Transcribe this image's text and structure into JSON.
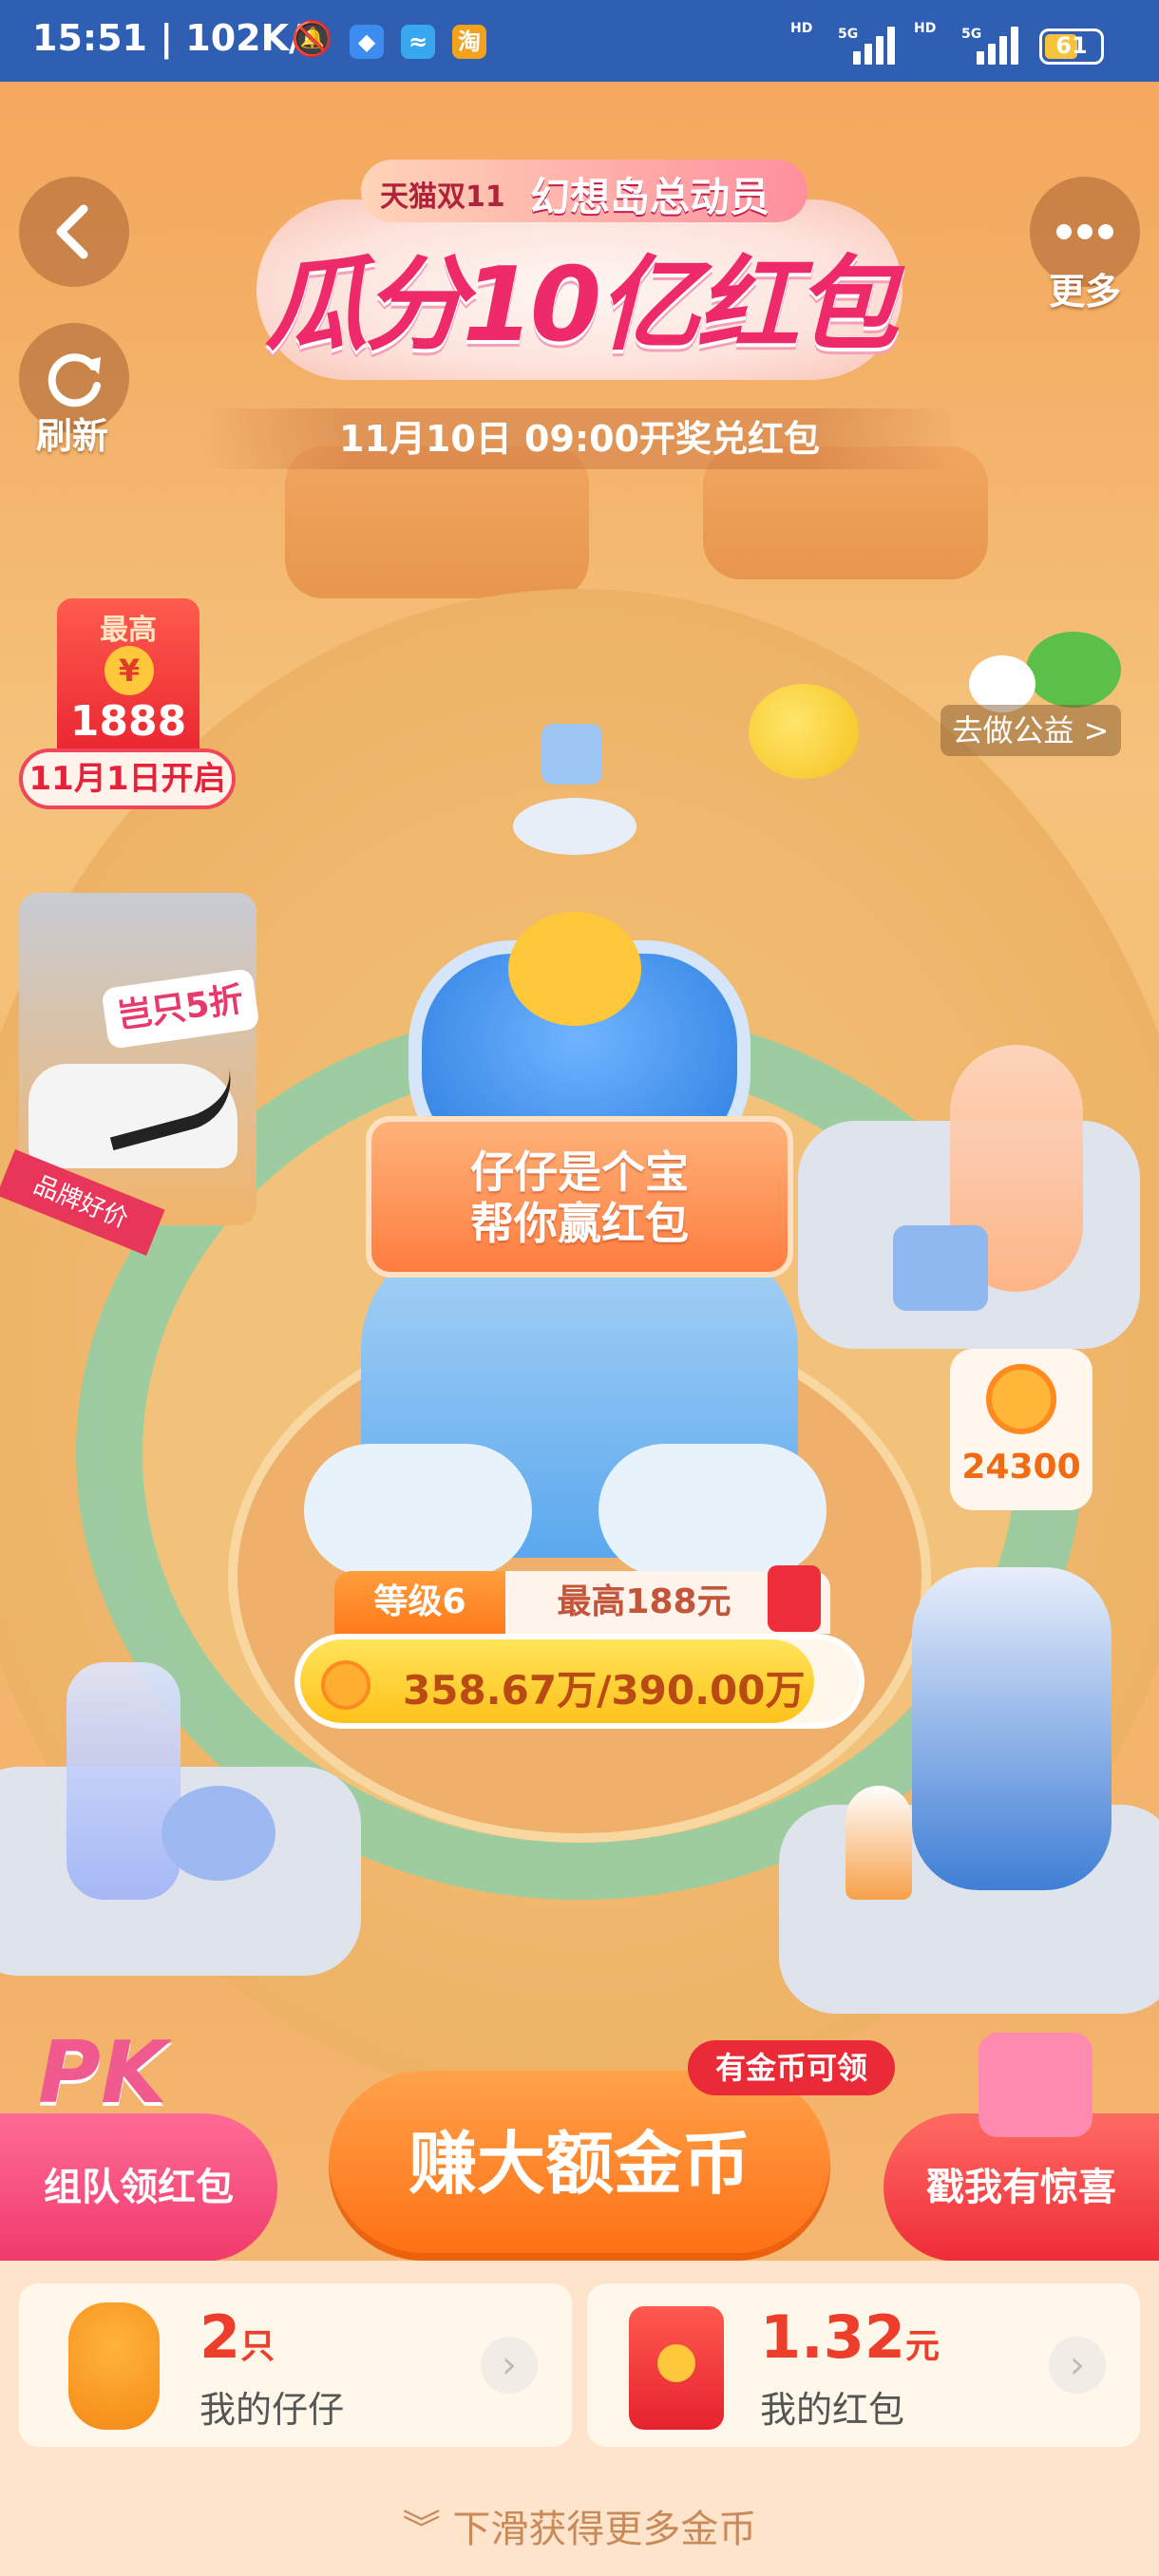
{
  "status_bar": {
    "time": "15:51 | 102K/s",
    "net1": "5G",
    "net2": "5G",
    "battery": "61",
    "battery_level": 0.61
  },
  "header": {
    "back_icon": "chevron-left-icon",
    "refresh_label": "刷新",
    "more_label": "更多",
    "banner_tag_left": "天猫双11",
    "banner_tag_right": "幻想岛总动员",
    "banner_title": "瓜分10亿红包",
    "draw_date": "11月10日 09:00开奖兑红包"
  },
  "scene": {
    "redpacket_top": "最高",
    "redpacket_symbol": "¥",
    "redpacket_amount": "1888",
    "redpacket_open": "11月1日开启",
    "welfare_label": "去做公益 >",
    "booth_discount": "岂只5折",
    "booth_strip": "品牌好价",
    "robot_sign_line1": "仔仔是个宝",
    "robot_sign_line2": "帮你赢红包",
    "coin_count": "24300"
  },
  "level_panel": {
    "level_label": "等级6",
    "max_label": "最高188元",
    "progress_text": "358.67万/390.00万",
    "progress_fraction": 0.9197
  },
  "actions": {
    "pk_text": "PK",
    "team_label": "组队领红包",
    "earn_label": "赚大额金币",
    "earn_badge": "有金币可领",
    "surprise_label": "戳我有惊喜"
  },
  "cards": {
    "zai_value": "2",
    "zai_unit": "只",
    "zai_label": "我的仔仔",
    "redpacket_value": "1.32",
    "redpacket_unit": "元",
    "redpacket_label": "我的红包"
  },
  "footer": {
    "swipe_label": "下滑获得更多金币"
  },
  "colors": {
    "status_bar": "#2f5fb3",
    "accent_orange": "#ff7a1a",
    "accent_red": "#ea2a36",
    "pink": "#f03a6c"
  }
}
